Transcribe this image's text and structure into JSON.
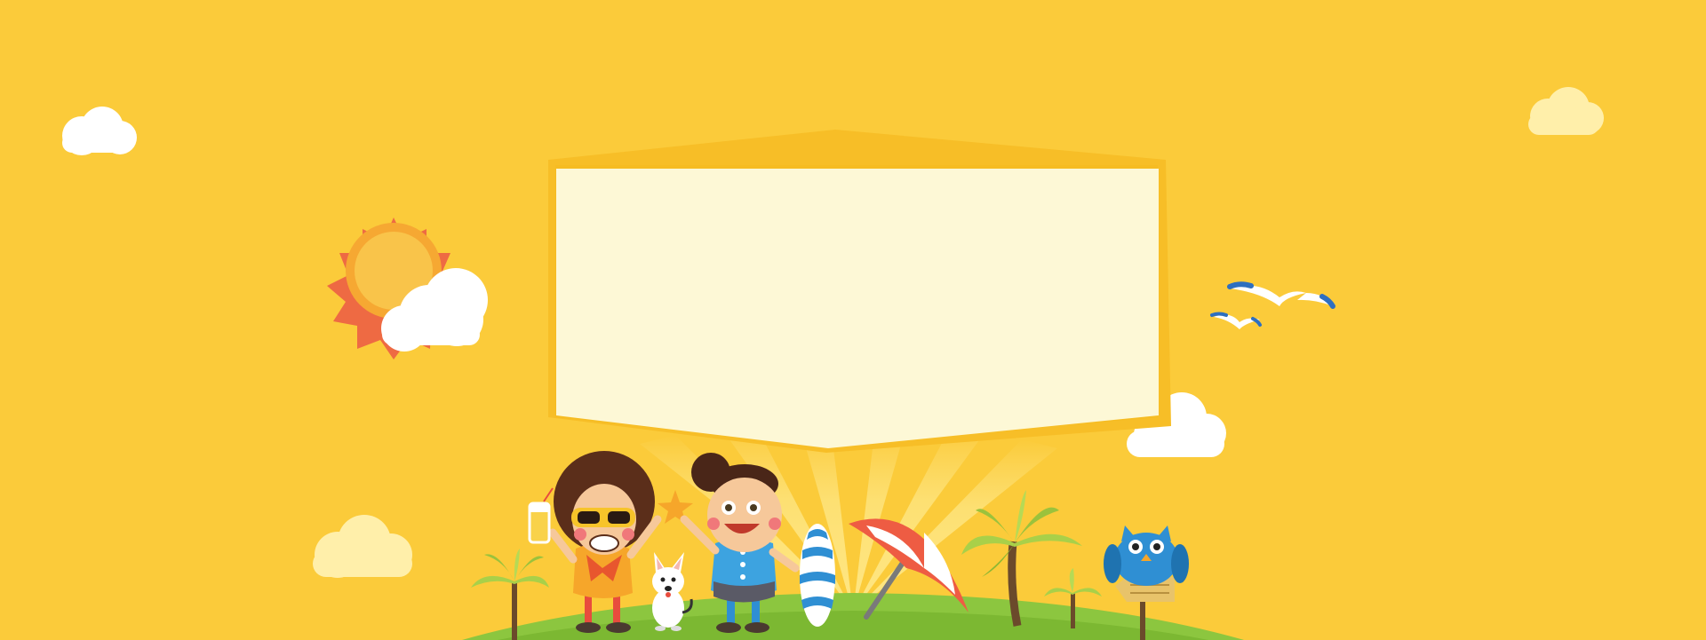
{
  "theme": {
    "background": "#FBCB3A",
    "panel_fill": "#FDF8D6",
    "panel_border": "#F7BE27",
    "ground": "#8CC63F",
    "sun_outer": "#EE6A43",
    "sun_inner": "#F7BA3E",
    "cloud_white": "#FFFFFF",
    "cloud_cream": "#FFEFAA",
    "owl_blue": "#2F8FD3",
    "umbrella_red": "#EE5C43",
    "palm_leaf": "#A9D049",
    "trunk_brown": "#6B4A2B"
  },
  "icons": [
    "cloud-icon",
    "sun-icon",
    "seagull-icon",
    "palm-tree-icon",
    "beach-umbrella-icon",
    "surfboard-icon",
    "owl-icon",
    "signpost-icon",
    "dog-icon",
    "girl-icon",
    "boy-icon",
    "drink-icon"
  ]
}
